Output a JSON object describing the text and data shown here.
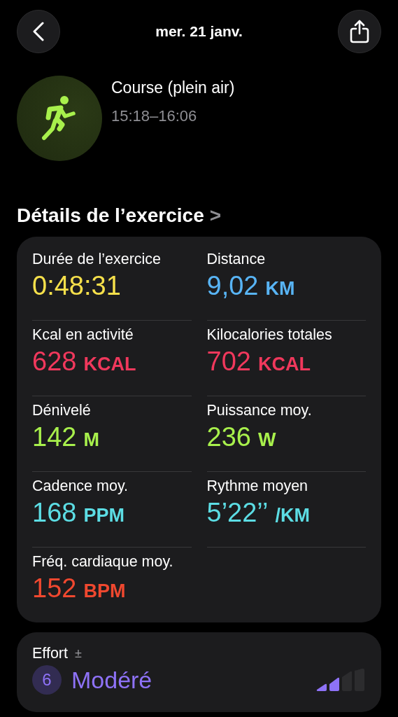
{
  "header": {
    "title": "mer. 21 janv."
  },
  "workout": {
    "name": "Course (plein air)",
    "time": "15:18–16:06"
  },
  "section": {
    "title": "Détails de l’exercice",
    "chevron": ">"
  },
  "metrics": [
    {
      "label": "Durée de l’exercice",
      "value": "0:48:31",
      "color": "#f6e04b"
    },
    {
      "label": "Distance",
      "value": "9,02",
      "unit": "KM",
      "color": "#58b4f5"
    },
    {
      "label": "Kcal en activité",
      "value": "628",
      "unit": "KCAL",
      "color": "#f0385c"
    },
    {
      "label": "Kilocalories totales",
      "value": "702",
      "unit": "KCAL",
      "color": "#f0385c"
    },
    {
      "label": "Dénivelé",
      "value": "142",
      "unit": "M",
      "color": "#a8f04c"
    },
    {
      "label": "Puissance moy.",
      "value": "236",
      "unit": "W",
      "color": "#a8f04c"
    },
    {
      "label": "Cadence moy.",
      "value": "168",
      "unit": "PPM",
      "color": "#5cdde4"
    },
    {
      "label": "Rythme moyen",
      "value": "5’22’’",
      "unit": "/KM",
      "color": "#5cdde4"
    },
    {
      "label": "Fréq. cardiaque moy.",
      "value": "152",
      "unit": "BPM",
      "color": "#f0482f"
    }
  ],
  "effort": {
    "label": "Effort",
    "symbol": "±",
    "score": "6",
    "rating": "Modéré",
    "level": 0.5
  }
}
